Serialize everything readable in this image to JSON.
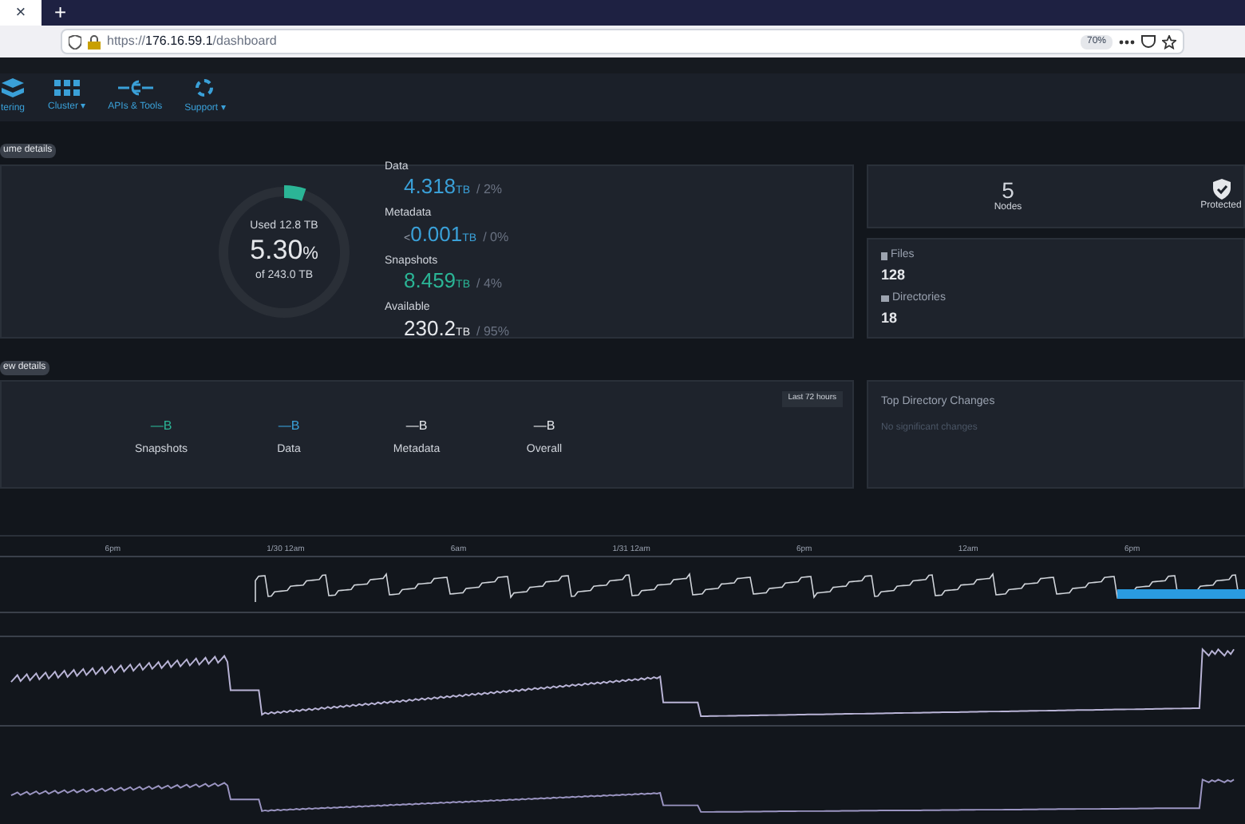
{
  "browser": {
    "url_prefix": "https://",
    "url_host": "176.16.59.1",
    "url_path": "/dashboard",
    "zoom": "70%",
    "new_tab": "+",
    "close_tab": "×"
  },
  "nav": {
    "items": [
      {
        "label": "tering",
        "kind": "monitor"
      },
      {
        "label": "Cluster ▾",
        "kind": "grid"
      },
      {
        "label": "APIs & Tools",
        "kind": "api"
      },
      {
        "label": "Support ▾",
        "kind": "support"
      }
    ]
  },
  "capacity": {
    "section_label": "ume details",
    "used_label": "Used 12.8 TB",
    "percent": "5.30",
    "percent_sign": "%",
    "total": "of 243.0 TB",
    "level": 0.053,
    "rows": [
      {
        "label": "Data",
        "prefix": "",
        "value": "4.318",
        "unit": "TB",
        "share": "/ 2%",
        "color": "#3aa0d8"
      },
      {
        "label": "Metadata",
        "prefix": "<",
        "value": "0.001",
        "unit": "TB",
        "share": "/ 0%",
        "color": "#3aa0d8"
      },
      {
        "label": "Snapshots",
        "prefix": "",
        "value": "8.459",
        "unit": "TB",
        "share": "/ 4%",
        "color": "#2bb596"
      },
      {
        "label": "Available",
        "prefix": "",
        "value": "230.2",
        "unit": "TB",
        "share": "/ 95%",
        "color": "#e5e7eb"
      }
    ]
  },
  "summary": {
    "nodes_count": "5",
    "nodes_label": "Nodes",
    "protection_label": "Protected",
    "files_label": "Files",
    "files_count": "128",
    "dirs_label": "Directories",
    "dirs_count": "18"
  },
  "activity": {
    "section_label": "ew details",
    "range_button": "Last 72 hours",
    "legend": [
      {
        "value": "—B",
        "label": "Snapshots",
        "color": "#2bb596"
      },
      {
        "value": "—B",
        "label": "Data",
        "color": "#3aa0d8"
      },
      {
        "value": "—B",
        "label": "Metadata",
        "color": "#e5e7eb"
      },
      {
        "value": "—B",
        "label": "Overall",
        "color": "#e5e7eb"
      }
    ]
  },
  "changes": {
    "title": "Top Directory Changes",
    "empty_text": "No significant changes"
  },
  "timeline": {
    "ticks": [
      "6pm",
      "1/30 12am",
      "6am",
      "1/31 12am",
      "6pm",
      "12am",
      "6pm"
    ]
  }
}
